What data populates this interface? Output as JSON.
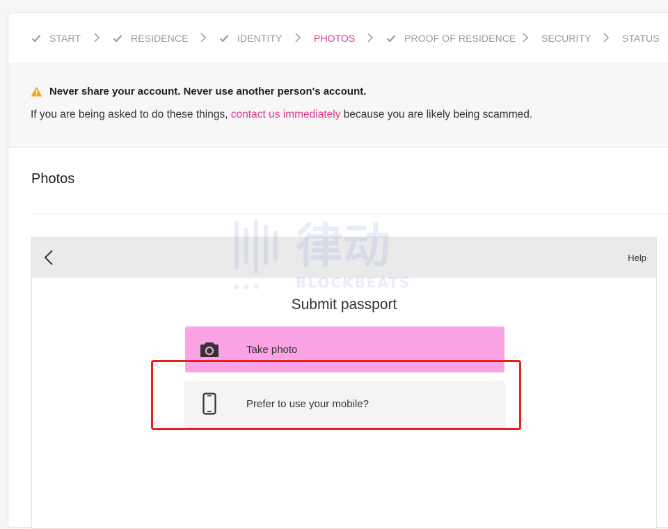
{
  "stepper": {
    "steps": [
      {
        "label": "START",
        "state": "done"
      },
      {
        "label": "RESIDENCE",
        "state": "done"
      },
      {
        "label": "IDENTITY",
        "state": "done"
      },
      {
        "label": "PHOTOS",
        "state": "active"
      },
      {
        "label": "PROOF OF RESIDENCE",
        "state": "done"
      },
      {
        "label": "SECURITY",
        "state": "pending"
      },
      {
        "label": "STATUS",
        "state": "pending"
      }
    ]
  },
  "warning": {
    "icon": "warning-triangle-icon",
    "title": "Never share your account. Never use another person's account.",
    "text_before": "If you are being asked to do these things,",
    "link_text": "contact us immediately",
    "text_after": "because you are likely being scammed."
  },
  "section": {
    "title": "Photos"
  },
  "widget": {
    "back_icon": "chevron-left-icon",
    "help_label": "Help",
    "title": "Submit passport",
    "options": {
      "take_photo": {
        "label": "Take photo",
        "icon": "camera-icon"
      },
      "mobile": {
        "label": "Prefer to use your mobile?",
        "icon": "smartphone-icon"
      }
    }
  },
  "watermark": {
    "chinese": "律动",
    "english": "BLOCKBEATS"
  },
  "colors": {
    "accent": "#e0358f",
    "take_photo_bg": "#fca3e5",
    "highlight": "#e8201d",
    "warning_icon": "#f5a623"
  }
}
